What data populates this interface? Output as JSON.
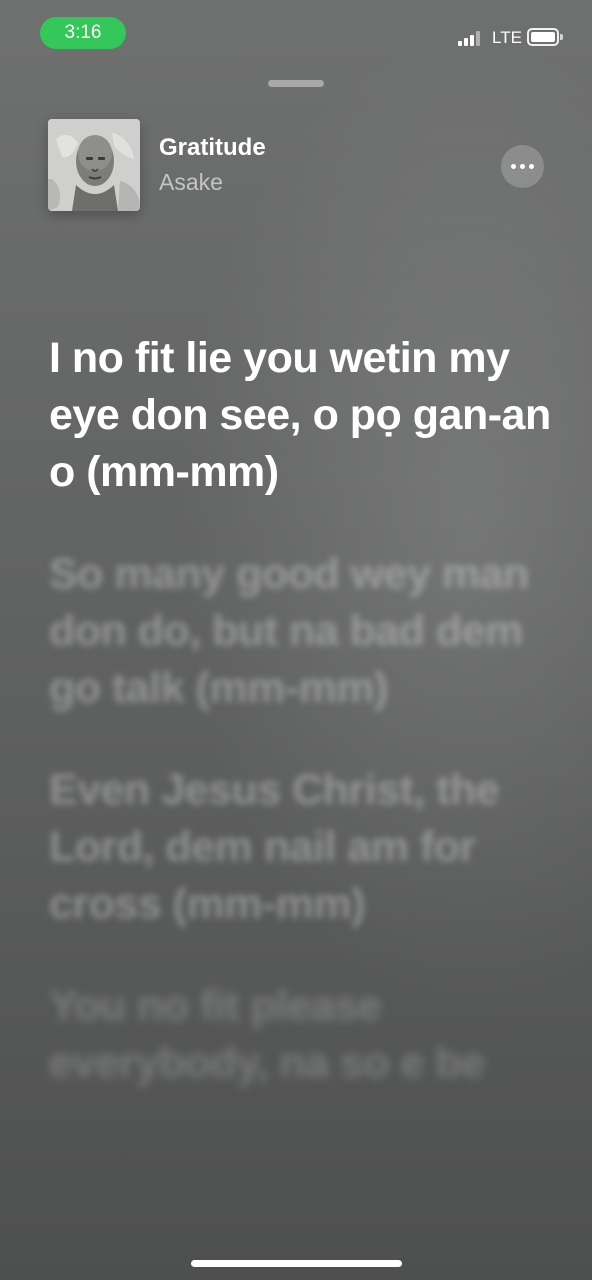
{
  "status_bar": {
    "time": "3:16",
    "network": "LTE",
    "signal_icon": "cellular-signal-icon",
    "battery_icon": "battery-icon",
    "time_pill_color": "#34c759"
  },
  "track": {
    "title": "Gratitude",
    "artist": "Asake",
    "artwork_icon": "album-artwork",
    "more_icon": "ellipsis-icon"
  },
  "lyrics": {
    "lines": [
      "I no fit lie you wetin my eye don see, o pọ gan-an o (mm-mm)",
      "So many good wey man don do, but na bad dem go talk (mm-mm)",
      "Even Jesus Christ, the Lord, dem nail am for cross (mm-mm)",
      "You no fit please everybody, na so e be"
    ],
    "active_index": 0
  }
}
